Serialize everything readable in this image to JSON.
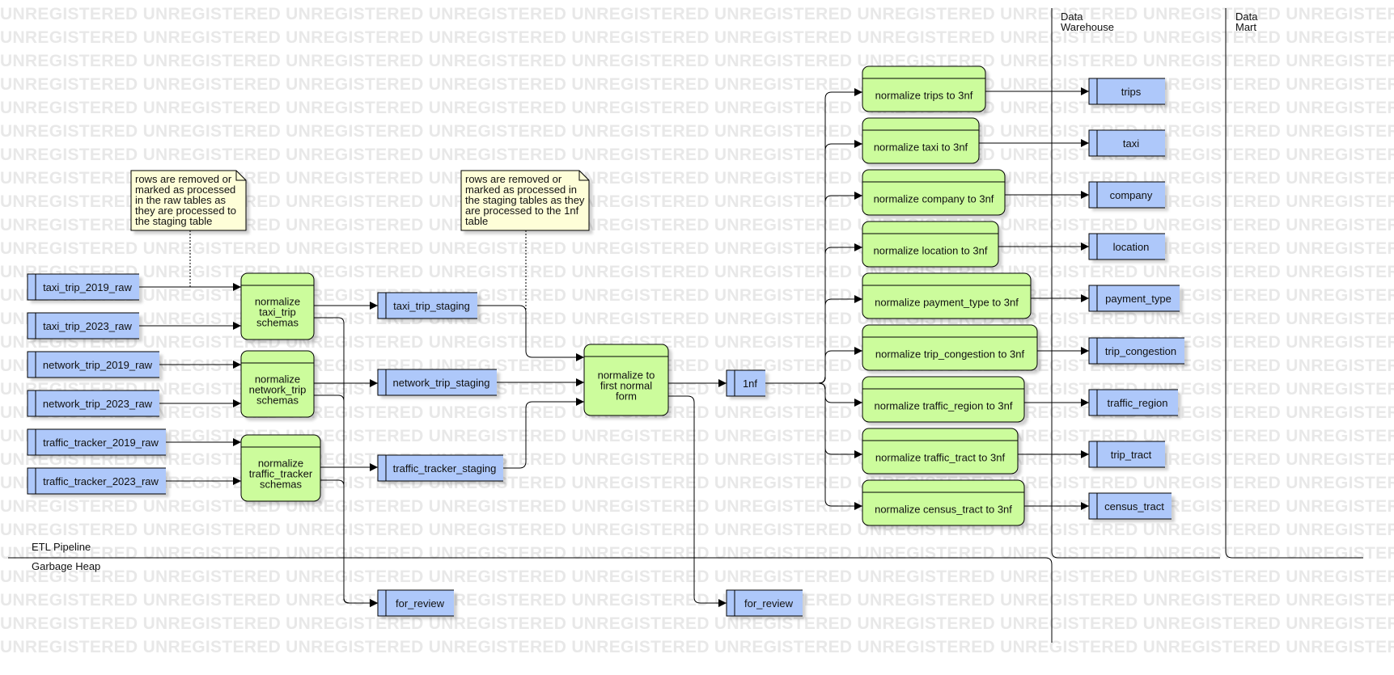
{
  "watermark": {
    "text": "UNREGISTERED"
  },
  "lanes": {
    "etl": "ETL Pipeline",
    "garbage": "Garbage Heap",
    "warehouse": [
      "Data",
      "Warehouse"
    ],
    "mart": [
      "Data",
      "Mart"
    ]
  },
  "notes": {
    "raw": [
      "rows are removed or",
      "marked as processed",
      "in the raw tables as",
      "they are processed to",
      "the staging table"
    ],
    "staging": [
      "rows are removed or",
      "marked as processed in",
      "the staging tables as they",
      "are processed to the 1nf",
      "table"
    ]
  },
  "stores": {
    "taxi_2019": "taxi_trip_2019_raw",
    "taxi_2023": "taxi_trip_2023_raw",
    "network_2019": "network_trip_2019_raw",
    "network_2023": "network_trip_2023_raw",
    "traffic_2019": "traffic_tracker_2019_raw",
    "traffic_2023": "traffic_tracker_2023_raw",
    "taxi_staging": "taxi_trip_staging",
    "network_staging": "network_trip_staging",
    "traffic_staging": "traffic_tracker_staging",
    "review_1": "for_review",
    "review_2": "for_review",
    "nf1": "1nf",
    "trips": "trips",
    "taxi": "taxi",
    "company": "company",
    "location": "location",
    "payment_type": "payment_type",
    "trip_congestion": "trip_congestion",
    "traffic_region": "traffic_region",
    "trip_tract": "trip_tract",
    "census_tract": "census_tract"
  },
  "processes": {
    "norm_taxi": [
      "normalize",
      "taxi_trip",
      "schemas"
    ],
    "norm_network": [
      "normalize",
      "network_trip",
      "schemas"
    ],
    "norm_traffic": [
      "normalize",
      "traffic_tracker",
      "schemas"
    ],
    "first_nf": [
      "normalize to",
      "first normal",
      "form"
    ],
    "trips_3nf": "normalize trips to 3nf",
    "taxi_3nf": "normalize taxi to 3nf",
    "company_3nf": "normalize company to 3nf",
    "location_3nf": "normalize location to 3nf",
    "payment_3nf": "normalize payment_type to 3nf",
    "congestion_3nf": "normalize trip_congestion to 3nf",
    "region_3nf": "normalize traffic_region to 3nf",
    "tract_3nf": "normalize traffic_tract to 3nf",
    "census_3nf": "normalize census_tract to 3nf"
  },
  "colors": {
    "store_fill": "#aec8fa",
    "process_fill": "#ccfc9c",
    "note_fill": "#fefed8",
    "line": "#000000",
    "watermark": "#e8e8e8"
  }
}
